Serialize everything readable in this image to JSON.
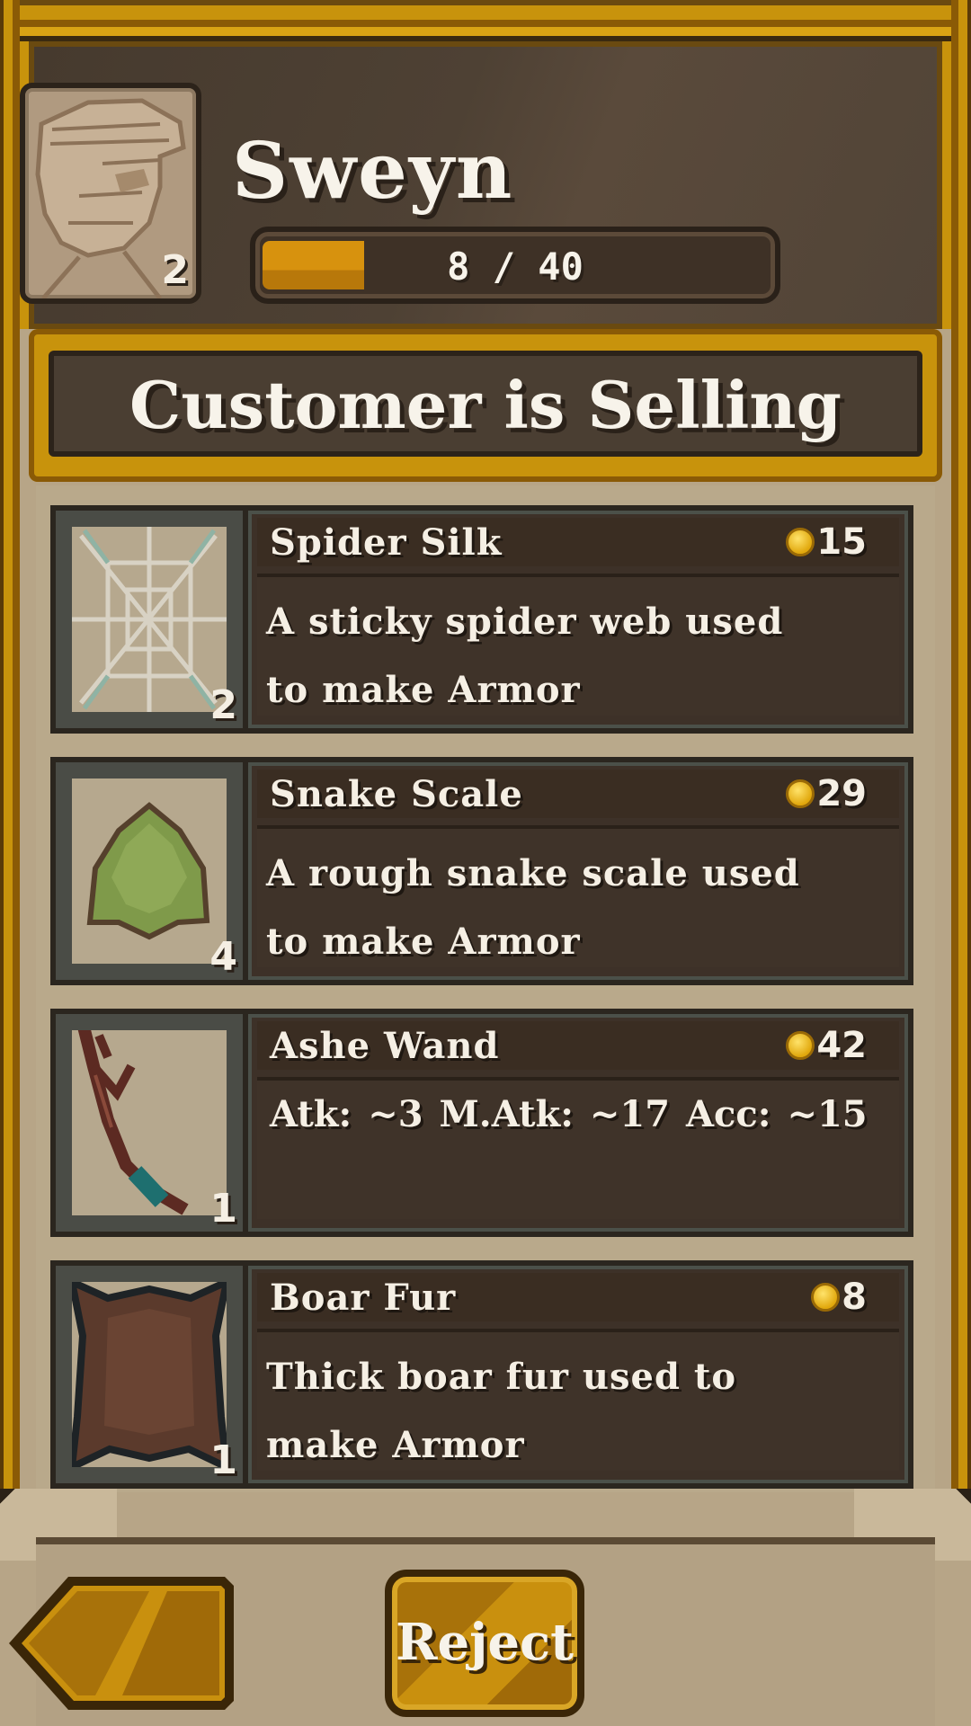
{
  "customer": {
    "name": "Sweyn",
    "level": "2",
    "xp_text": "8 / 40",
    "xp_progress": 0.2
  },
  "banner": {
    "title": "Customer is Selling"
  },
  "items": [
    {
      "name": "Spider Silk",
      "price": "15",
      "count": "2",
      "desc_lines": [
        "A sticky spider web used",
        "to make Armor"
      ],
      "icon": "spider-silk-icon"
    },
    {
      "name": "Snake Scale",
      "price": "29",
      "count": "4",
      "desc_lines": [
        "A rough snake scale used",
        "to make Armor"
      ],
      "icon": "snake-scale-icon"
    },
    {
      "name": "Ashe Wand",
      "price": "42",
      "count": "1",
      "stats": "Atk: ~3    M.Atk: ~17  Acc: ~15",
      "icon": "ashe-wand-icon"
    },
    {
      "name": "Boar Fur",
      "price": "8",
      "count": "1",
      "desc_lines": [
        "Thick boar fur used to",
        "make Armor"
      ],
      "icon": "boar-fur-icon"
    }
  ],
  "buttons": {
    "reject_label": "Reject",
    "back_icon": "back-arrow-icon"
  },
  "colors": {
    "gold_frame": "#c8930c",
    "panel_dark": "#3d3128",
    "parchment": "#b7a587",
    "coin": "#e1a80d"
  }
}
